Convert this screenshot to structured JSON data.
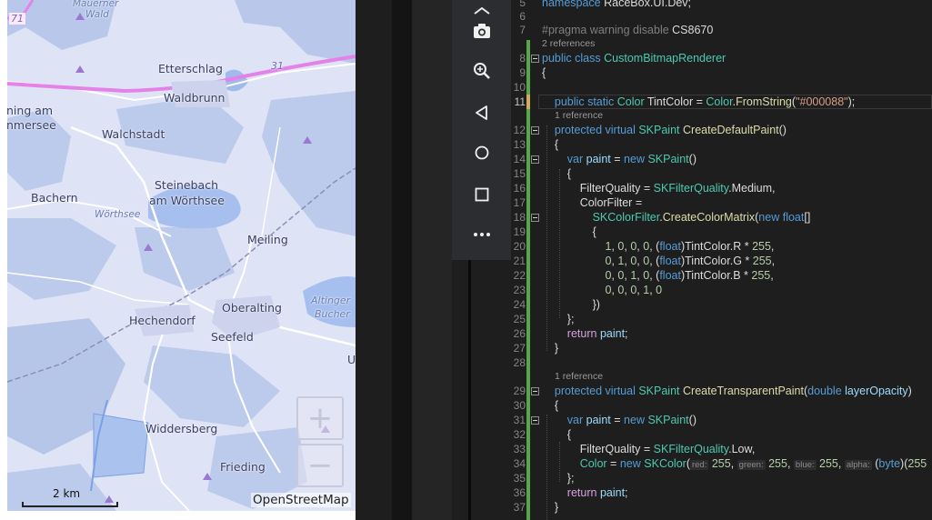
{
  "map": {
    "places": [
      {
        "name": "Mauerner",
        "kind": "small"
      },
      {
        "name": "Wald",
        "kind": "small"
      },
      {
        "name": "Etterschlag",
        "kind": "town"
      },
      {
        "name": "Waldbrunn",
        "kind": "town"
      },
      {
        "name": "ning am",
        "kind": "town"
      },
      {
        "name": "nmersee",
        "kind": "town"
      },
      {
        "name": "Walchstadt",
        "kind": "town"
      },
      {
        "name": "Steinebach",
        "kind": "town"
      },
      {
        "name": "am Wörthsee",
        "kind": "town"
      },
      {
        "name": "Wörthsee",
        "kind": "water"
      },
      {
        "name": "Bachern",
        "kind": "town"
      },
      {
        "name": "Meiling",
        "kind": "town"
      },
      {
        "name": "Oberalting",
        "kind": "town"
      },
      {
        "name": "Altinger",
        "kind": "water"
      },
      {
        "name": "Bucher",
        "kind": "water"
      },
      {
        "name": "Hechendorf",
        "kind": "town"
      },
      {
        "name": "Seefeld",
        "kind": "town"
      },
      {
        "name": "Widdersberg",
        "kind": "town"
      },
      {
        "name": "Frieding",
        "kind": "town"
      }
    ],
    "road_labels": [
      "71",
      "31"
    ],
    "edge_letter": "U",
    "zoom_in": "+",
    "zoom_out": "−",
    "scale": "2 km",
    "attribution": "OpenStreetMap"
  },
  "editor": {
    "lines": [
      {
        "n": "5",
        "text": "namespace RaceBox.UI.Dev;"
      },
      {
        "n": "6",
        "text": ""
      },
      {
        "n": "7",
        "text": "#pragma warning disable CS8670"
      },
      {
        "n": "8",
        "text": "public class CustomBitmapRenderer"
      },
      {
        "n": "9",
        "text": "{"
      },
      {
        "n": "10",
        "text": ""
      },
      {
        "n": "11",
        "text": "    public static Color TintColor = Color.FromString(\"#000088\");"
      },
      {
        "n": "12",
        "text": "    protected virtual SKPaint CreateDefaultPaint()"
      },
      {
        "n": "13",
        "text": "    {"
      },
      {
        "n": "14",
        "text": "        var paint = new SKPaint()"
      },
      {
        "n": "15",
        "text": "        {"
      },
      {
        "n": "16",
        "text": "            FilterQuality = SKFilterQuality.Medium,"
      },
      {
        "n": "17",
        "text": "            ColorFilter ="
      },
      {
        "n": "18",
        "text": "                SKColorFilter.CreateColorMatrix(new float[]"
      },
      {
        "n": "19",
        "text": "                {"
      },
      {
        "n": "20",
        "text": "                    1, 0, 0, 0, (float)TintColor.R * 255,"
      },
      {
        "n": "21",
        "text": "                    0, 1, 0, 0, (float)TintColor.G * 255,"
      },
      {
        "n": "22",
        "text": "                    0, 0, 1, 0, (float)TintColor.B * 255,"
      },
      {
        "n": "23",
        "text": "                    0, 0, 0, 1, 0"
      },
      {
        "n": "24",
        "text": "                })"
      },
      {
        "n": "25",
        "text": "        };"
      },
      {
        "n": "26",
        "text": "        return paint;"
      },
      {
        "n": "27",
        "text": "    }"
      },
      {
        "n": "28",
        "text": ""
      },
      {
        "n": "29",
        "text": "    protected virtual SKPaint CreateTransparentPaint(double layerOpacity)"
      },
      {
        "n": "30",
        "text": "    {"
      },
      {
        "n": "31",
        "text": "        var paint = new SKPaint()"
      },
      {
        "n": "32",
        "text": "        {"
      },
      {
        "n": "33",
        "text": "            FilterQuality = SKFilterQuality.Low,"
      },
      {
        "n": "34",
        "text": "            Color = new SKColor(red: 255, green: 255, blue: 255, alpha: (byte)(255"
      },
      {
        "n": "35",
        "text": "        };"
      },
      {
        "n": "36",
        "text": "        return paint;"
      },
      {
        "n": "37",
        "text": "    }"
      }
    ],
    "codelens": {
      "refs2": "2 references",
      "ref1a": "1 reference",
      "ref1b": "1 reference"
    },
    "param_hints": {
      "red": "red:",
      "green": "green:",
      "blue": "blue:",
      "alpha": "alpha:"
    }
  },
  "toolbar": {
    "buttons": [
      "camera-icon",
      "zoom-in-icon",
      "back-icon",
      "home-icon",
      "overview-icon",
      "more-icon"
    ]
  },
  "colors": {
    "map_bg": "#d9e0f4",
    "editor_bg": "#1e1e1e",
    "keyword": "#569cd6",
    "type": "#4ec9b0",
    "string": "#d69d85",
    "change_bar": "#57a64a"
  }
}
